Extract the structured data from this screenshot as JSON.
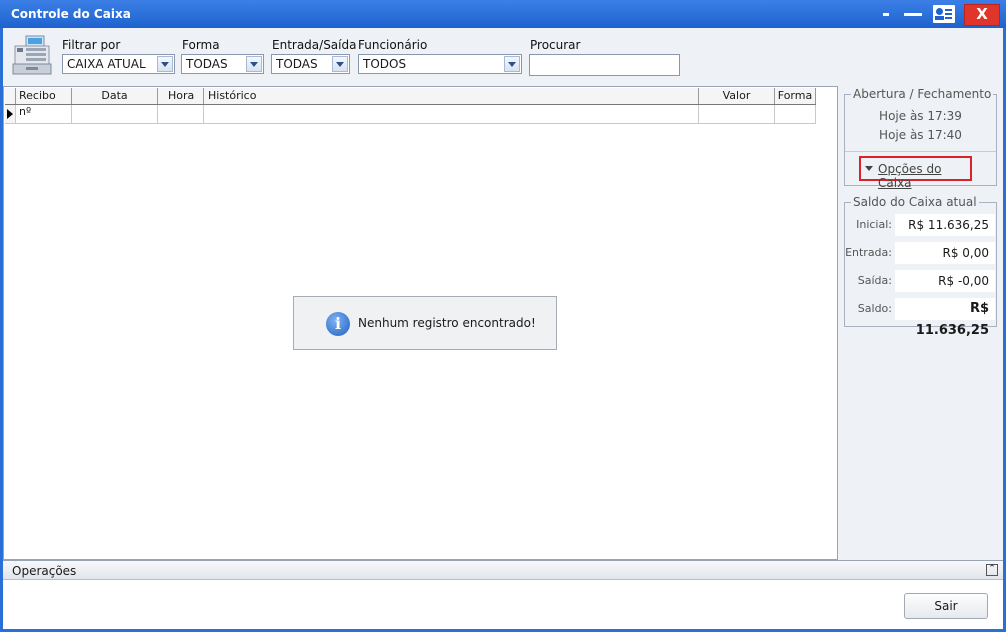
{
  "window": {
    "title": "Controle do Caixa",
    "close_label": "X"
  },
  "filters": {
    "filtrar_label": "Filtrar por",
    "filtrar_value": "CAIXA ATUAL",
    "forma_label": "Forma",
    "forma_value": "TODAS",
    "entrada_label": "Entrada/Saída",
    "entrada_value": "TODAS",
    "funcionario_label": "Funcionário",
    "funcionario_value": "TODOS",
    "procurar_label": "Procurar",
    "procurar_value": ""
  },
  "grid": {
    "columns": [
      "Recibo nº",
      "Data",
      "Hora",
      "Histórico",
      "Valor",
      "Forma"
    ],
    "empty_message": "Nenhum registro encontrado!"
  },
  "abertura": {
    "title": "Abertura / Fechamento",
    "abertura_time": "Hoje às 17:39",
    "fechamento_time": "Hoje às 17:40",
    "opcoes_label": "Opções do Caixa"
  },
  "saldo": {
    "title": "Saldo do Caixa atual",
    "inicial_label": "Inicial:",
    "inicial_value": "R$ 11.636,25",
    "entrada_label": "Entrada:",
    "entrada_value": "R$ 0,00",
    "saida_label": "Saída:",
    "saida_value": "R$ -0,00",
    "saldo_label": "Saldo:",
    "saldo_value": "R$ 11.636,25"
  },
  "operacoes": {
    "label": "Operações"
  },
  "footer": {
    "sair_label": "Sair"
  }
}
